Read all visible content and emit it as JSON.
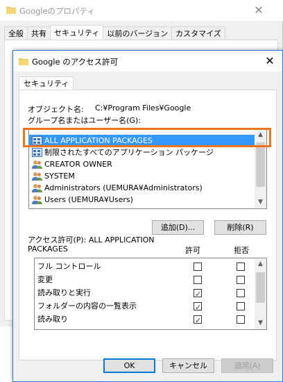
{
  "back_window": {
    "title": "Googleのプロパティ",
    "tabs": [
      "全般",
      "共有",
      "セキュリティ",
      "以前のバージョン",
      "カスタマイズ"
    ],
    "active_tab": "セキュリティ",
    "close_label": "✕"
  },
  "dialog": {
    "title": "Google のアクセス許可",
    "close_label": "✕",
    "tab_label": "セキュリティ",
    "object_name_label": "オブジェクト名:",
    "object_name_value": "C:¥Program Files¥Google",
    "group_label": "グループ名またはユーザー名(G):",
    "users": [
      {
        "label": "ALL APPLICATION PACKAGES",
        "icon": "app-package-icon",
        "selected": true
      },
      {
        "label": "制限されたすべてのアプリケーション パッケージ",
        "icon": "app-package-icon",
        "selected": false
      },
      {
        "label": "CREATOR OWNER",
        "icon": "user-group-icon",
        "selected": false
      },
      {
        "label": "SYSTEM",
        "icon": "user-group-icon",
        "selected": false
      },
      {
        "label": "Administrators (UEMURA¥Administrators)",
        "icon": "user-group-icon",
        "selected": false
      },
      {
        "label": "Users (UEMURA¥Users)",
        "icon": "user-group-icon",
        "selected": false
      }
    ],
    "add_button": "追加(D)...",
    "remove_button": "削除(R)",
    "permissions_label": "アクセス許可(P): ALL APPLICATION PACKAGES",
    "allow_header": "許可",
    "deny_header": "拒否",
    "permissions": [
      {
        "label": "フル コントロール",
        "allow": false,
        "deny": false
      },
      {
        "label": "変更",
        "allow": false,
        "deny": false
      },
      {
        "label": "読み取りと実行",
        "allow": true,
        "deny": false
      },
      {
        "label": "フォルダーの内容の一覧表示",
        "allow": true,
        "deny": false
      },
      {
        "label": "読み取り",
        "allow": true,
        "deny": false
      }
    ],
    "ok_button": "OK",
    "cancel_button": "キャンセル",
    "apply_button": "適用(A)"
  },
  "colors": {
    "selection": "#3399ff",
    "highlight_border": "#f0741a",
    "accent": "#0078d7"
  }
}
